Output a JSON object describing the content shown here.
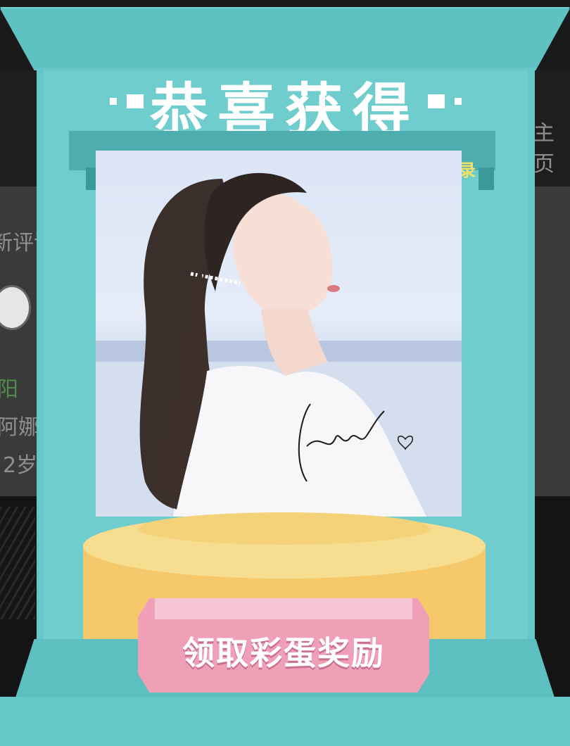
{
  "background_app": {
    "right_label": "主页",
    "left_lines": [
      "新评论",
      "阳",
      "阿娜",
      "2岁"
    ]
  },
  "modal": {
    "title": "恭喜获得",
    "ribbon_glyph": "录",
    "prize_image_icon": "portrait-photo",
    "cta_label": "领取彩蛋奖励"
  },
  "colors": {
    "frame": "#66c7c8",
    "pedestal": "#f5c96b",
    "cta": "#ef9fb6",
    "title_text": "#ffffff"
  }
}
